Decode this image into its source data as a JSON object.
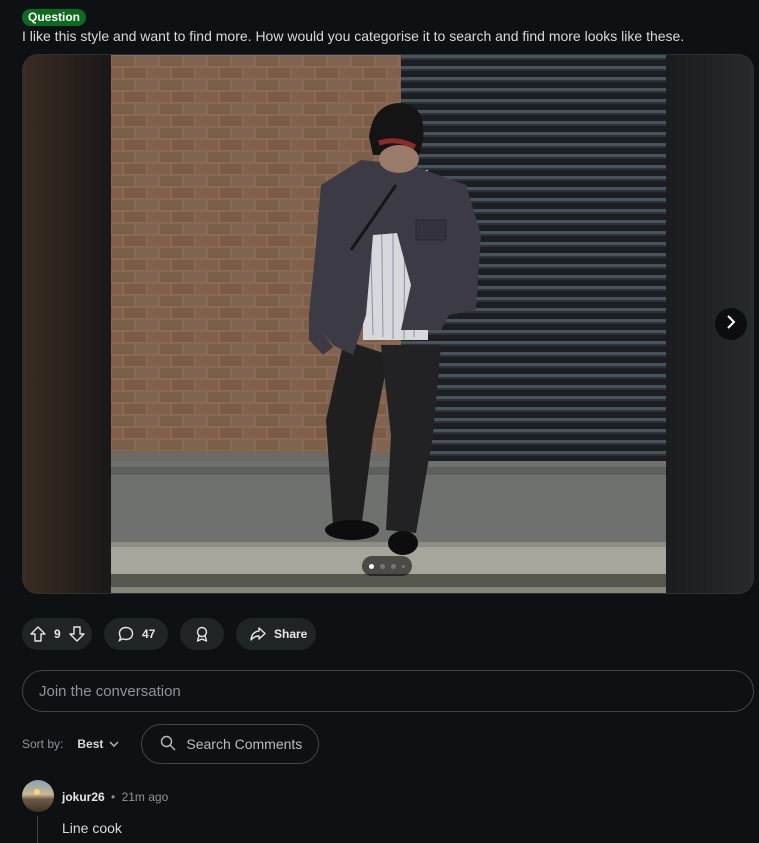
{
  "post": {
    "flair": "Question",
    "title": "I like this style and want to find more. How would you categorise it to search and find more looks like these."
  },
  "gallery": {
    "current_index": 1,
    "total_images": 4,
    "next_icon": "chevron-right-icon"
  },
  "actions": {
    "vote_count": "9",
    "comment_count": "47",
    "share_label": "Share",
    "upvote_icon": "arrow-up-icon",
    "downvote_icon": "arrow-down-icon",
    "comment_icon": "speech-bubble-icon",
    "award_icon": "award-icon",
    "share_icon": "share-arrow-icon"
  },
  "composer": {
    "placeholder": "Join the conversation"
  },
  "sort": {
    "label": "Sort by:",
    "value": "Best",
    "search_placeholder": "Search Comments"
  },
  "comments": [
    {
      "user": "jokur26",
      "separator": "•",
      "time": "21m ago",
      "body": "Line cook"
    }
  ],
  "colors": {
    "flair_bg": "#0b6b1f",
    "background": "#0e1113",
    "pill_bg": "#1f2426"
  }
}
